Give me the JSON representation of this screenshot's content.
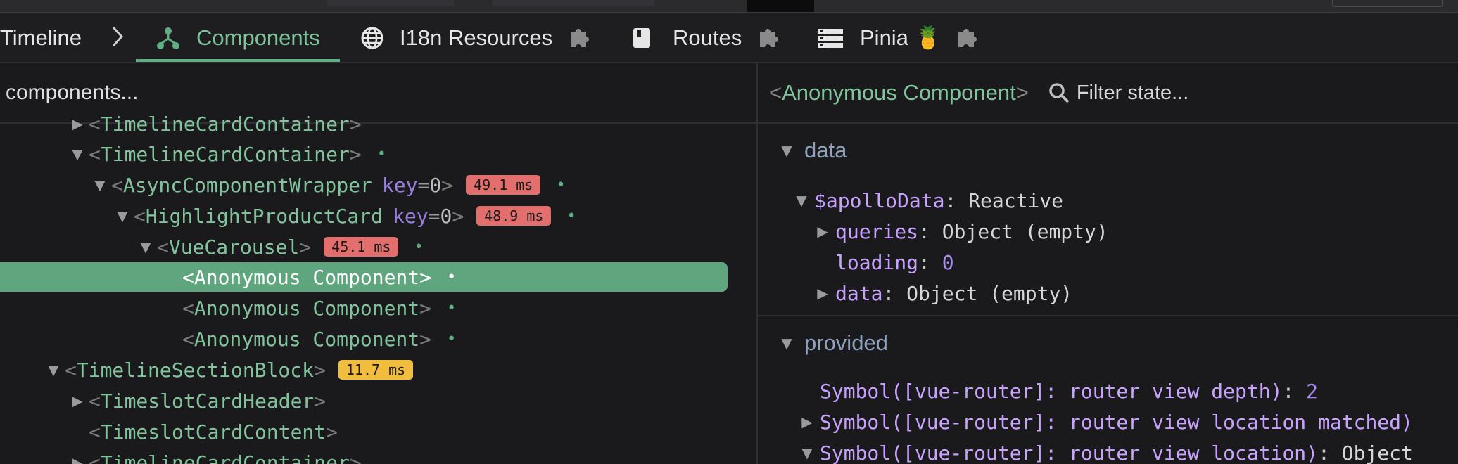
{
  "tabs": {
    "timeline": "Timeline",
    "components": "Components",
    "i18n": "I18n Resources",
    "routes": "Routes",
    "pinia": "Pinia 🍍"
  },
  "colors": {
    "accent": "#5faf83",
    "selected_row": "#5fa57d",
    "badge_red": "#e26e6e",
    "badge_yellow": "#f0be3c",
    "key_purple": "#9b7fe0",
    "section_blue": "#8fa3c0"
  },
  "component_search": {
    "placeholder": "components..."
  },
  "tree": {
    "rows": [
      {
        "name": "TimelineCardContainer"
      },
      {
        "name": "TimelineCardContainer"
      },
      {
        "name": "AsyncComponentWrapper",
        "key": "key",
        "key_value": "0",
        "time": "49.1 ms"
      },
      {
        "name": "HighlightProductCard",
        "key": "key",
        "key_value": "0",
        "time": "48.9 ms"
      },
      {
        "name": "VueCarousel",
        "time": "45.1 ms"
      },
      {
        "name": "Anonymous Component"
      },
      {
        "name": "Anonymous Component"
      },
      {
        "name": "Anonymous Component"
      },
      {
        "name": "TimelineSectionBlock",
        "time": "11.7 ms"
      },
      {
        "name": "TimeslotCardHeader"
      },
      {
        "name": "TimeslotCardContent"
      },
      {
        "name": "TimelineCardContainer"
      }
    ],
    "lt": "<",
    "gt": ">",
    "eq": "=",
    "dot": "•"
  },
  "inspector": {
    "component_name": "Anonymous Component",
    "filter_placeholder": "Filter state...",
    "data_section": {
      "title": "data",
      "items": [
        {
          "key": "$apolloData",
          "sep": ":",
          "value": "Reactive"
        },
        {
          "key": "queries",
          "sep": ":",
          "value": "Object (empty)"
        },
        {
          "key": "loading",
          "sep": ":",
          "value": "0"
        },
        {
          "key": "data",
          "sep": ":",
          "value": "Object (empty)"
        }
      ]
    },
    "provided_section": {
      "title": "provided",
      "items": [
        {
          "key": "Symbol([vue-router]: router view depth)",
          "sep": ":",
          "value": "2"
        },
        {
          "key": "Symbol([vue-router]: router view location matched)"
        },
        {
          "key": "Symbol([vue-router]: router view location)",
          "sep": ":",
          "value": "Object"
        }
      ]
    }
  },
  "icons": [
    "chevron-right-icon",
    "component-tree-icon",
    "globe-icon",
    "puzzle-icon",
    "book-icon",
    "list-icon",
    "search-icon",
    "triangle-down-icon",
    "triangle-right-icon"
  ]
}
